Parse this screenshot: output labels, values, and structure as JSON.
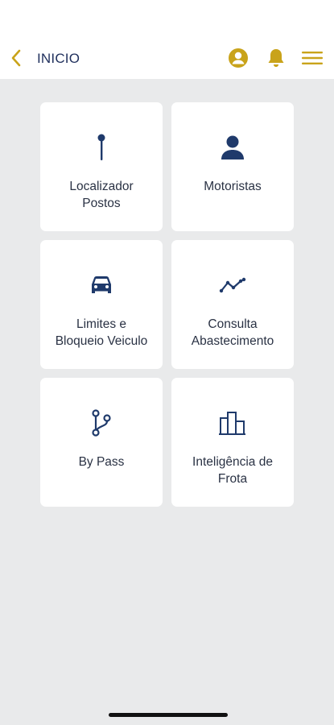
{
  "header": {
    "title": "INICIO",
    "accent_color": "#c9a31a",
    "title_color": "#1f2f5c"
  },
  "menu": [
    {
      "icon": "pin-icon",
      "label": "Localizador\nPostos"
    },
    {
      "icon": "person-icon",
      "label": "Motoristas"
    },
    {
      "icon": "car-icon",
      "label": "Limites e\nBloqueio Veiculo"
    },
    {
      "icon": "trend-icon",
      "label": "Consulta\nAbastecimento"
    },
    {
      "icon": "branch-icon",
      "label": "By Pass"
    },
    {
      "icon": "bar-chart-icon",
      "label": "Inteligência de\nFrota"
    }
  ]
}
